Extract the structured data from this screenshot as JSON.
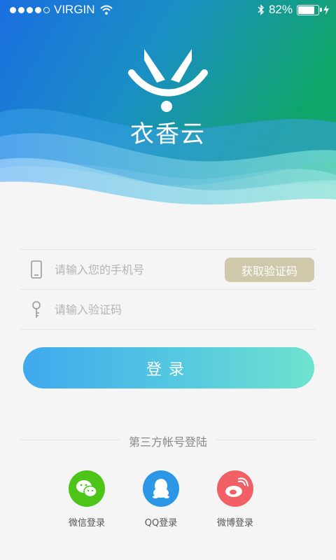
{
  "status_bar": {
    "carrier": "VIRGIN",
    "battery_percent": "82%",
    "battery_level": 0.82
  },
  "brand": {
    "name": "衣香云"
  },
  "login_form": {
    "phone_placeholder": "请输入您的手机号",
    "code_placeholder": "请输入验证码",
    "get_code_label": "获取验证码",
    "submit_label": "登录"
  },
  "third_party": {
    "title": "第三方帐号登陆",
    "options": [
      {
        "label": "微信登录",
        "icon": "wechat-icon",
        "color": "#4cc418"
      },
      {
        "label": "QQ登录",
        "icon": "qq-icon",
        "color": "#2c97e6"
      },
      {
        "label": "微博登录",
        "icon": "weibo-icon",
        "color": "#f06066"
      }
    ]
  },
  "colors": {
    "get_code_button": "#cfc8ab",
    "login_gradient_start": "#3fa9ee",
    "login_gradient_end": "#6fe2cf",
    "background": "#f5f5f5"
  }
}
